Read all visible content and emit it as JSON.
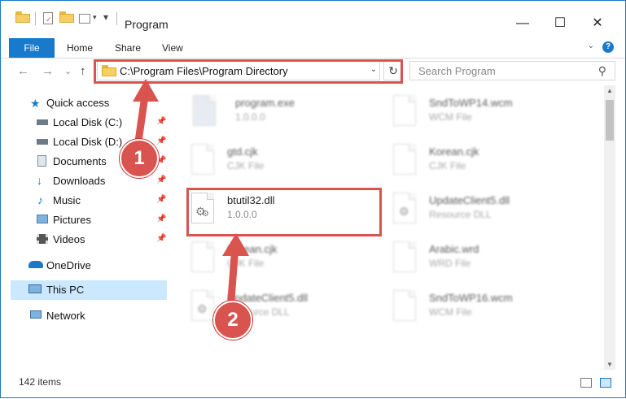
{
  "window": {
    "title": "Program",
    "controls": {
      "minimize": "—",
      "maximize": "☐",
      "close": "✕"
    }
  },
  "ribbon": {
    "tabs": [
      "File",
      "Home",
      "Share",
      "View"
    ],
    "help": "?"
  },
  "address": {
    "path": "C:\\Program Files\\Program Directory",
    "refresh": "↻",
    "search_placeholder": "Search Program",
    "nav": {
      "back": "←",
      "forward": "→",
      "recent": "⌄",
      "up": "↑"
    }
  },
  "sidebar": {
    "items": [
      {
        "label": "Quick access",
        "icon": "star-icon",
        "pinned": false
      },
      {
        "label": "Local Disk (C:)",
        "icon": "drive-icon",
        "pinned": true
      },
      {
        "label": "Local Disk (D:)",
        "icon": "drive-icon",
        "pinned": true
      },
      {
        "label": "Documents",
        "icon": "documents-icon",
        "pinned": true
      },
      {
        "label": "Downloads",
        "icon": "downloads-icon",
        "pinned": true
      },
      {
        "label": "Music",
        "icon": "music-icon",
        "pinned": true
      },
      {
        "label": "Pictures",
        "icon": "pictures-icon",
        "pinned": true
      },
      {
        "label": "Videos",
        "icon": "videos-icon",
        "pinned": true
      },
      {
        "label": "OneDrive",
        "icon": "onedrive-icon",
        "pinned": false
      },
      {
        "label": "This PC",
        "icon": "pc-icon",
        "pinned": false,
        "selected": true
      },
      {
        "label": "Network",
        "icon": "network-icon",
        "pinned": false
      }
    ]
  },
  "files": [
    {
      "name": "program.exe",
      "sub": "1.0.0.0",
      "blurred": true
    },
    {
      "name": "SndToWP14.wcm",
      "sub": "WCM File",
      "blurred": true
    },
    {
      "name": "gtd.cjk",
      "sub": "CJK File",
      "blurred": true
    },
    {
      "name": "Korean.cjk",
      "sub": "CJK File",
      "blurred": true
    },
    {
      "name": "btutil32.dll",
      "sub": "1.0.0.0",
      "blurred": false
    },
    {
      "name": "UpdateClient5.dll",
      "sub": "Resource DLL",
      "blurred": true
    },
    {
      "name": "Korean.cjk",
      "sub": "CJK File",
      "blurred": true
    },
    {
      "name": "Arabic.wrd",
      "sub": "WRD File",
      "blurred": true
    },
    {
      "name": "UpdateClient5.dll",
      "sub": "Resource DLL",
      "blurred": true
    },
    {
      "name": "SndToWP16.wcm",
      "sub": "WCM File",
      "blurred": true
    }
  ],
  "status": {
    "count": "142 items"
  },
  "callouts": [
    "1",
    "2"
  ],
  "colors": {
    "accent": "#1979ca",
    "highlight": "#d9534f",
    "selected": "#cce8ff"
  }
}
